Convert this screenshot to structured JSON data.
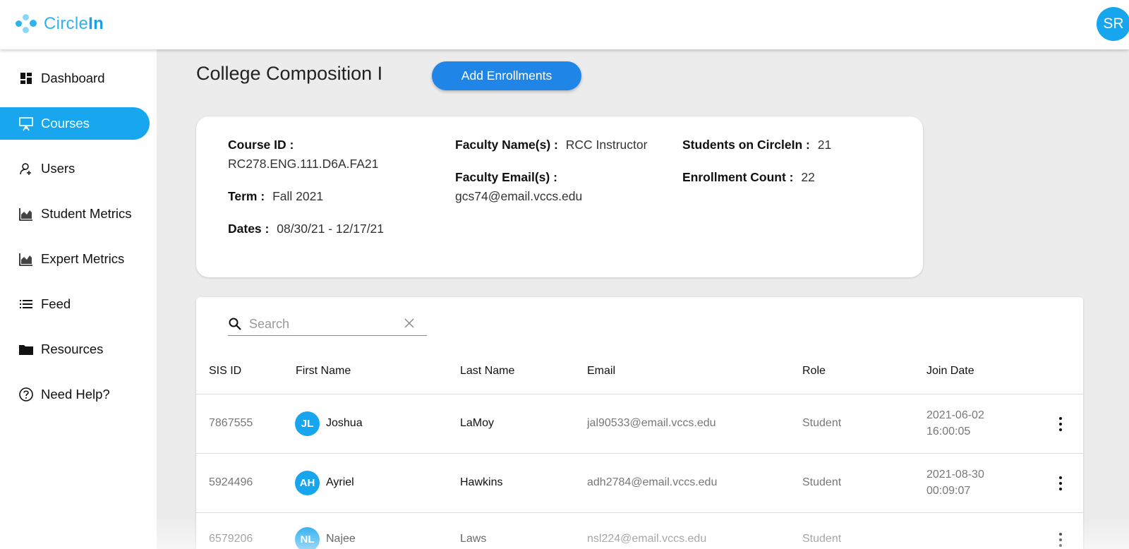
{
  "app": {
    "logo_text_light": "Circle",
    "logo_text_bold": "In",
    "user_initials": "SR",
    "accent_color": "#18a7ef"
  },
  "sidebar": {
    "items": [
      {
        "label": "Dashboard",
        "icon": "dashboard-icon"
      },
      {
        "label": "Courses",
        "icon": "presentation-board-icon",
        "active": true
      },
      {
        "label": "Users",
        "icon": "users-icon"
      },
      {
        "label": "Student Metrics",
        "icon": "area-chart-icon"
      },
      {
        "label": "Expert Metrics",
        "icon": "area-chart-icon"
      },
      {
        "label": "Feed",
        "icon": "list-icon"
      },
      {
        "label": "Resources",
        "icon": "folder-icon"
      },
      {
        "label": "Need Help?",
        "icon": "help-circle-icon"
      }
    ]
  },
  "page": {
    "title": "College Composition I",
    "add_button": "Add Enrollments"
  },
  "course": {
    "course_id_label": "Course ID :",
    "course_id": "RC278.ENG.111.D6A.FA21",
    "term_label": "Term :",
    "term": "Fall 2021",
    "dates_label": "Dates :",
    "dates": "08/30/21 - 12/17/21",
    "faculty_name_label": "Faculty Name(s) :",
    "faculty_name": "RCC Instructor",
    "faculty_email_label": "Faculty Email(s) :",
    "faculty_email": "gcs74@email.vccs.edu",
    "students_label": "Students on CircleIn :",
    "students": "21",
    "enrollment_label": "Enrollment Count :",
    "enrollment": "22"
  },
  "table": {
    "search_placeholder": "Search",
    "columns": [
      "SIS ID",
      "First Name",
      "Last Name",
      "Email",
      "Role",
      "Join Date"
    ],
    "rows": [
      {
        "sis_id": "7867555",
        "initials": "JL",
        "first": "Joshua",
        "last": "LaMoy",
        "email": "jal90533@email.vccs.edu",
        "role": "Student",
        "date": "2021-06-02",
        "time": "16:00:05"
      },
      {
        "sis_id": "5924496",
        "initials": "AH",
        "first": "Ayriel",
        "last": "Hawkins",
        "email": "adh2784@email.vccs.edu",
        "role": "Student",
        "date": "2021-08-30",
        "time": "00:09:07"
      },
      {
        "sis_id": "6579206",
        "initials": "NL",
        "first": "Najee",
        "last": "Laws",
        "email": "nsl224@email.vccs.edu",
        "role": "Student",
        "date": "",
        "time": ""
      }
    ]
  }
}
